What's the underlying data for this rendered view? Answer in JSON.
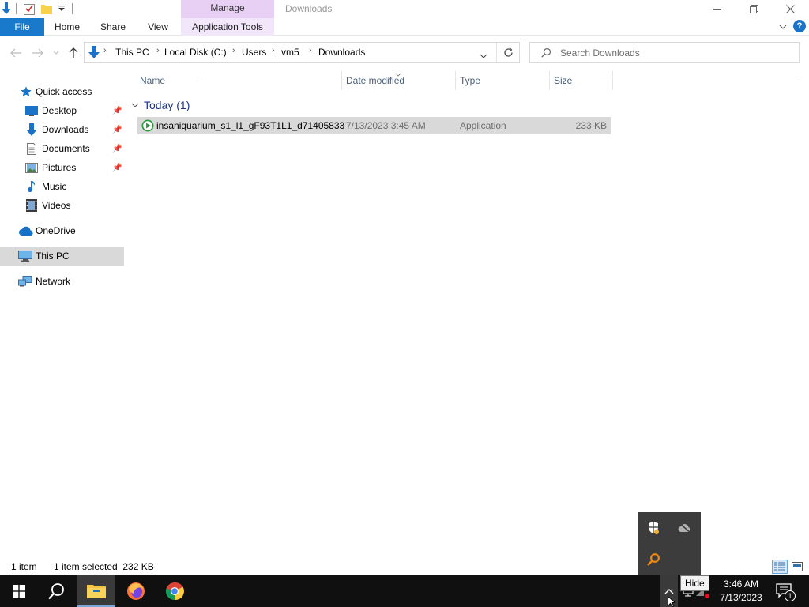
{
  "window": {
    "title": "Downloads",
    "manage_tab": "Manage"
  },
  "ribbon": {
    "file": "File",
    "home": "Home",
    "share": "Share",
    "view": "View",
    "application_tools": "Application Tools"
  },
  "address": {
    "crumbs": [
      "This PC",
      "Local Disk (C:)",
      "Users",
      "vm5",
      "Downloads"
    ]
  },
  "search": {
    "placeholder": "Search Downloads"
  },
  "nav": {
    "quick_access": "Quick access",
    "desktop": "Desktop",
    "downloads": "Downloads",
    "documents": "Documents",
    "pictures": "Pictures",
    "music": "Music",
    "videos": "Videos",
    "onedrive": "OneDrive",
    "this_pc": "This PC",
    "network": "Network"
  },
  "columns": {
    "name": "Name",
    "date_modified": "Date modified",
    "type": "Type",
    "size": "Size"
  },
  "group": {
    "label": "Today (1)"
  },
  "files": [
    {
      "name": "insaniquarium_s1_l1_gF93T1L1_d71405833",
      "date": "7/13/2023 3:45 AM",
      "type": "Application",
      "size": "233 KB"
    }
  ],
  "status": {
    "item_count": "1 item",
    "selection": "1 item selected  232 KB"
  },
  "taskbar": {
    "time": "3:46 AM",
    "date": "7/13/2023",
    "tooltip": "Hide",
    "notification_count": "1"
  },
  "colors": {
    "file_tab": "#1979ca",
    "manage_tab": "#e8d0f5",
    "selected_row": "#d9d9d9",
    "taskbar": "#101010",
    "group_header": "#1e3287"
  }
}
